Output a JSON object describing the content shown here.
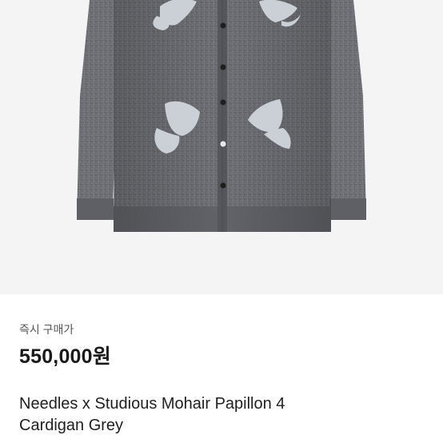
{
  "product": {
    "purchase_label": "즉시 구매가",
    "price": "550,000원",
    "title_line1": "Needles x Studious Mohair Papillon 4",
    "title_line2": "Cardigan Grey"
  },
  "colors": {
    "image_background": "#f4f4f4",
    "cardigan_grey": "#6e6e73",
    "butterfly": "#cfd6dc",
    "text_primary": "#1a1a1a",
    "text_secondary": "#555555"
  }
}
